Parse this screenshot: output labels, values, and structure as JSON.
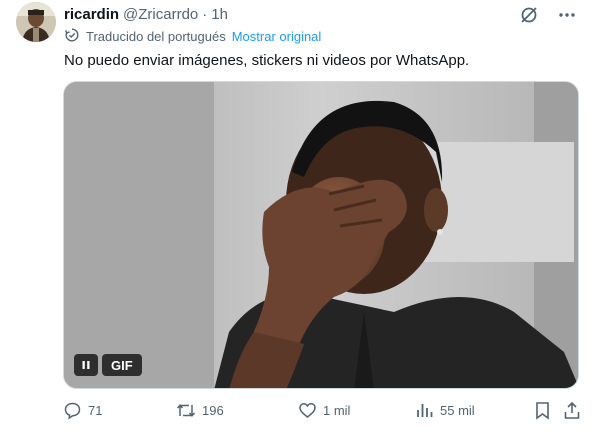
{
  "author": {
    "name": "ricardin",
    "handle": "@Zricarrdo",
    "separator": "·",
    "time": "1h"
  },
  "header_icons": [
    "grok-icon",
    "more-icon"
  ],
  "translation": {
    "label": "Traducido del portugués",
    "show_original": "Mostrar original"
  },
  "tweet_text": "No puedo enviar imágenes, stickers ni videos por WhatsApp.",
  "media": {
    "badge": "GIF",
    "pause_icon": "pause-icon"
  },
  "actions": {
    "replies": "71",
    "retweets": "196",
    "likes": "1 mil",
    "views": "55 mil"
  },
  "colors": {
    "accent": "#1d9bf0",
    "secondary_text": "#536471",
    "primary_text": "#0f1419"
  }
}
